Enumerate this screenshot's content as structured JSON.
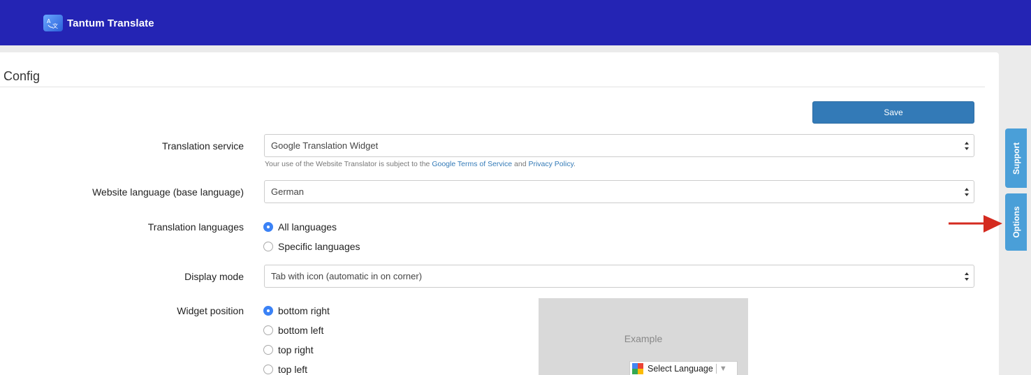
{
  "app": {
    "title": "Tantum Translate"
  },
  "panel": {
    "title": "Config"
  },
  "actions": {
    "save_label": "Save"
  },
  "colors": {
    "topbar": "#2424b4",
    "save_button": "#337ab7",
    "side_tabs": "#4a9fd8",
    "radio_selected": "#3b82f6",
    "arrow": "#d42a1f"
  },
  "fields": {
    "translation_service": {
      "label": "Translation service",
      "value": "Google Translation Widget",
      "help_prefix": "Your use of the Website Translator is subject to the",
      "help_link1": "Google Terms of Service",
      "help_and": "and",
      "help_link2": "Privacy Policy",
      "help_suffix": "."
    },
    "website_language": {
      "label": "Website language (base language)",
      "value": "German"
    },
    "translation_languages": {
      "label": "Translation languages",
      "options": [
        "All languages",
        "Specific languages"
      ],
      "selected": "All languages"
    },
    "display_mode": {
      "label": "Display mode",
      "value": "Tab with icon (automatic in on corner)"
    },
    "widget_position": {
      "label": "Widget position",
      "options": [
        "bottom right",
        "bottom left",
        "top right",
        "top left"
      ],
      "selected": "bottom right"
    }
  },
  "example": {
    "label": "Example",
    "widget_text": "Select Language",
    "caret": "▼"
  },
  "side_tabs": {
    "support": "Support",
    "options": "Options"
  }
}
